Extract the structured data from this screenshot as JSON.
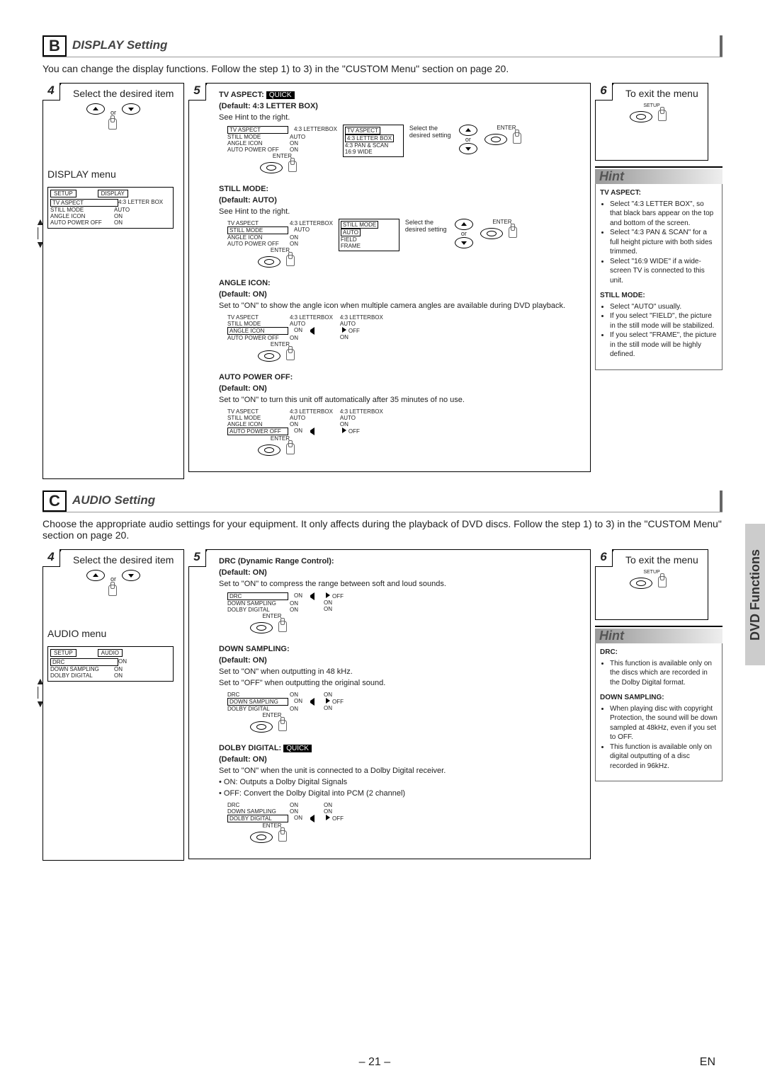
{
  "sideTab": "DVD Functions",
  "sectionB": {
    "letter": "B",
    "title": "DISPLAY Setting",
    "intro": "You can change the display functions. Follow the step 1) to 3) in the \"CUSTOM Menu\" section on page 20.",
    "step4": {
      "num": "4",
      "title": "Select the desired item",
      "or": "or",
      "menuTitle": "DISPLAY menu",
      "hdr1": "SETUP",
      "hdr2": "DISPLAY",
      "rows": [
        [
          "TV ASPECT",
          "4:3 LETTER BOX"
        ],
        [
          "STILL MODE",
          "AUTO"
        ],
        [
          "ANGLE ICON",
          "ON"
        ],
        [
          "AUTO POWER OFF",
          "ON"
        ]
      ]
    },
    "step5": {
      "num": "5",
      "tva": {
        "label": "TV ASPECT:",
        "quick": "QUICK",
        "def": "(Default: 4:3 LETTER BOX)",
        "hint": "See Hint to the right.",
        "side": "Select the desired setting",
        "menu": [
          [
            "TV ASPECT",
            "4:3 LETTERBOX"
          ],
          [
            "STILL MODE",
            "AUTO"
          ],
          [
            "ANGLE ICON",
            "ON"
          ],
          [
            "AUTO POWER OFF",
            "ON"
          ]
        ],
        "opts": [
          "TV ASPECT",
          "4:3 LETTER BOX",
          "4:3 PAN & SCAN",
          "16:9 WIDE"
        ],
        "enter": "ENTER"
      },
      "still": {
        "label": "STILL MODE:",
        "def": "(Default: AUTO)",
        "hint": "See Hint to the right.",
        "side": "Select the desired setting",
        "menu": [
          [
            "TV ASPECT",
            "4:3 LETTERBOX"
          ],
          [
            "STILL MODE",
            "AUTO"
          ],
          [
            "ANGLE ICON",
            "ON"
          ],
          [
            "AUTO POWER OFF",
            "ON"
          ]
        ],
        "opts": [
          "STILL MODE",
          "AUTO",
          "FIELD",
          "FRAME"
        ],
        "enter": "ENTER"
      },
      "angle": {
        "label": "ANGLE ICON:",
        "def": "(Default: ON)",
        "desc": "Set to \"ON\" to show the angle icon when multiple camera angles are available during DVD playback.",
        "menu": [
          [
            "TV ASPECT",
            "4:3 LETTERBOX"
          ],
          [
            "STILL MODE",
            "AUTO"
          ],
          [
            "ANGLE ICON",
            "ON"
          ],
          [
            "AUTO POWER OFF",
            "ON"
          ]
        ],
        "opts": [
          "4:3 LETTERBOX",
          "AUTO",
          "OFF",
          "ON"
        ],
        "enter": "ENTER"
      },
      "auto": {
        "label": "AUTO POWER OFF:",
        "def": "(Default: ON)",
        "desc": "Set to \"ON\" to turn this unit off automatically after 35 minutes of no use.",
        "menu": [
          [
            "TV ASPECT",
            "4:3 LETTERBOX"
          ],
          [
            "STILL MODE",
            "AUTO"
          ],
          [
            "ANGLE ICON",
            "ON"
          ],
          [
            "AUTO POWER OFF",
            "ON"
          ]
        ],
        "opts": [
          "4:3 LETTERBOX",
          "AUTO",
          "ON",
          "OFF"
        ],
        "enter": "ENTER"
      }
    },
    "step6": {
      "num": "6",
      "title": "To exit the menu",
      "setup": "SETUP"
    },
    "hint": {
      "title": "Hint",
      "tva": {
        "h": "TV ASPECT:",
        "items": [
          "Select \"4:3 LETTER BOX\", so that black bars appear on the top and bottom of the screen.",
          "Select \"4:3 PAN & SCAN\" for a full height picture with both sides trimmed.",
          "Select \"16:9 WIDE\" if a wide-screen TV is connected to this unit."
        ]
      },
      "still": {
        "h": "STILL MODE:",
        "items": [
          "Select \"AUTO\" usually.",
          "If you select \"FIELD\", the picture in the still mode will be stabilized.",
          "If you select \"FRAME\", the picture in the still mode will be highly defined."
        ]
      }
    }
  },
  "sectionC": {
    "letter": "C",
    "title": "AUDIO Setting",
    "intro": "Choose the appropriate audio settings for your equipment. It only affects during the playback of DVD discs. Follow the step 1) to 3) in the \"CUSTOM Menu\" section on page 20.",
    "step4": {
      "num": "4",
      "title": "Select the desired item",
      "or": "or",
      "menuTitle": "AUDIO menu",
      "hdr1": "SETUP",
      "hdr2": "AUDIO",
      "rows": [
        [
          "DRC",
          "ON"
        ],
        [
          "DOWN SAMPLING",
          "ON"
        ],
        [
          "DOLBY DIGITAL",
          "ON"
        ]
      ]
    },
    "step5": {
      "num": "5",
      "drc": {
        "label": "DRC (Dynamic Range Control):",
        "def": "(Default: ON)",
        "desc": "Set to \"ON\" to compress the range between soft and loud sounds.",
        "menu": [
          [
            "DRC",
            "ON"
          ],
          [
            "DOWN SAMPLING",
            "ON"
          ],
          [
            "DOLBY DIGITAL",
            "ON"
          ]
        ],
        "opts": [
          "OFF",
          "ON",
          "ON"
        ],
        "enter": "ENTER"
      },
      "down": {
        "label": "DOWN SAMPLING:",
        "def": "(Default: ON)",
        "desc1": "Set to \"ON\" when outputting in 48 kHz.",
        "desc2": "Set to \"OFF\" when outputting the original sound.",
        "menu": [
          [
            "DRC",
            "ON"
          ],
          [
            "DOWN SAMPLING",
            "ON"
          ],
          [
            "DOLBY DIGITAL",
            "ON"
          ]
        ],
        "opts": [
          "ON",
          "OFF",
          "ON"
        ],
        "enter": "ENTER"
      },
      "dolby": {
        "label": "DOLBY DIGITAL:",
        "quick": "QUICK",
        "def": "(Default: ON)",
        "desc": "Set to \"ON\" when the unit is connected to a Dolby Digital receiver.",
        "b1": "• ON: Outputs a Dolby Digital Signals",
        "b2": "• OFF: Convert the Dolby Digital into PCM (2 channel)",
        "menu": [
          [
            "DRC",
            "ON"
          ],
          [
            "DOWN SAMPLING",
            "ON"
          ],
          [
            "DOLBY DIGITAL",
            "ON"
          ]
        ],
        "opts": [
          "ON",
          "ON",
          "OFF"
        ],
        "enter": "ENTER"
      }
    },
    "step6": {
      "num": "6",
      "title": "To exit the menu",
      "setup": "SETUP"
    },
    "hint": {
      "title": "Hint",
      "drc": {
        "h": "DRC:",
        "items": [
          "This function is available only on the discs which are recorded in the Dolby Digital format."
        ]
      },
      "down": {
        "h": "DOWN SAMPLING:",
        "items": [
          "When playing disc with copyright Protection, the sound will be down sampled at 48kHz, even if you set to OFF.",
          "This function is available only on digital outputting of a disc recorded in 96kHz."
        ]
      }
    }
  },
  "footer": {
    "page": "– 21 –",
    "lang": "EN"
  }
}
